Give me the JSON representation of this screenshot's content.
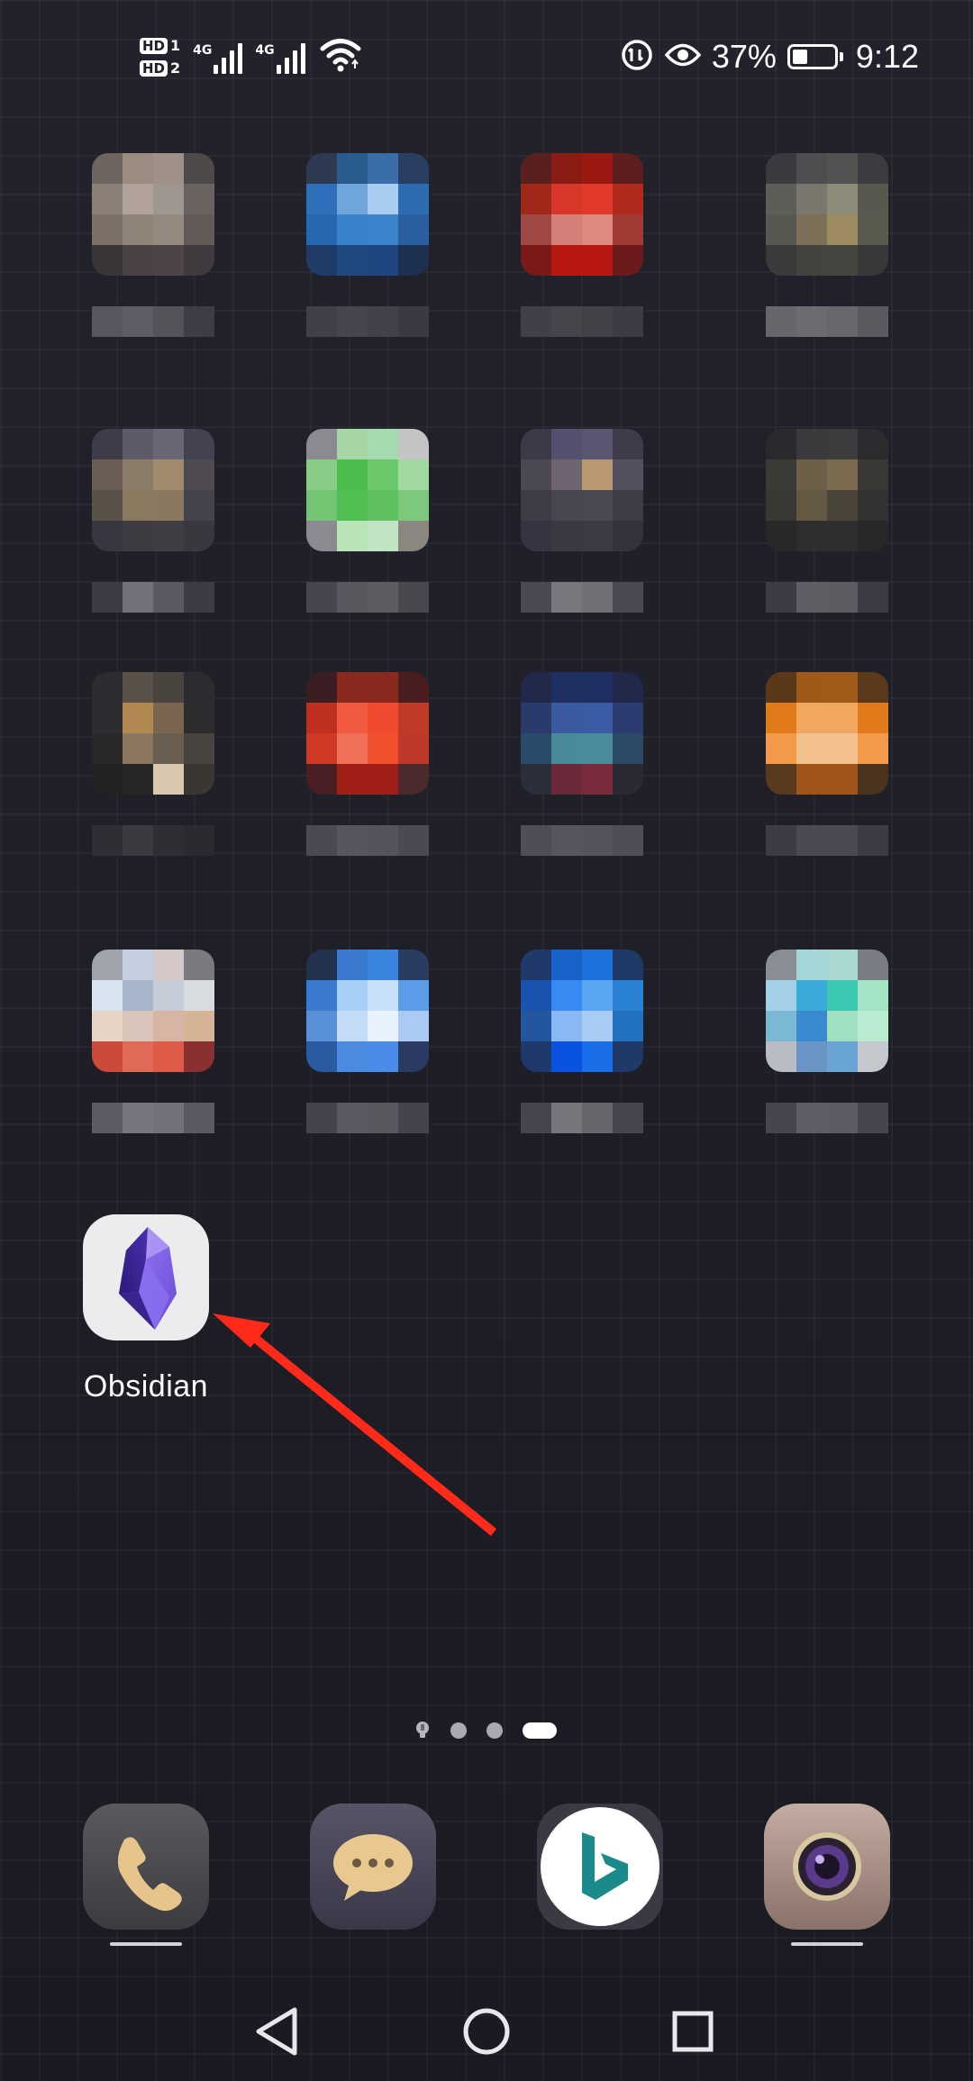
{
  "status_bar": {
    "sim1_badge": "HD",
    "sim1_slot": "1",
    "sim2_badge": "HD",
    "sim2_slot": "2",
    "net1_label": "4G",
    "net2_label": "4G",
    "battery_percent_text": "37%",
    "battery_level": 0.37,
    "time": "9:12",
    "icons": [
      "hd-sim1-icon",
      "hd-sim2-icon",
      "signal-sim1-icon",
      "signal-sim2-icon",
      "wifi-icon",
      "data-saver-icon",
      "eye-comfort-icon",
      "battery-icon"
    ]
  },
  "home_grid": {
    "blurred_apps": [
      {
        "row": 1,
        "col": 1,
        "colors": [
          "#6e6460",
          "#9a8c80",
          "#a0908a",
          "#4e4a4a",
          "#8a8078",
          "#b0a298",
          "#a09690",
          "#6a6260",
          "#7a7068",
          "#908478",
          "#948a80",
          "#625a58",
          "#3a3638",
          "#4a4246",
          "#4c4446",
          "#3e3a3e"
        ],
        "label_colors": [
          "#58565e",
          "#5e5c64",
          "#55535a",
          "#3e3c44"
        ]
      },
      {
        "row": 1,
        "col": 2,
        "colors": [
          "#2e3a52",
          "#2a5c8e",
          "#3a6ea8",
          "#2a3e62",
          "#2f6eb8",
          "#6ea6dc",
          "#a8cdf0",
          "#2e6cb2",
          "#2668b0",
          "#3a82cc",
          "#3c84cc",
          "#2a60a0",
          "#1e3c66",
          "#1e4a80",
          "#1e4680",
          "#1e3050"
        ],
        "label_colors": [
          "#404048",
          "#46464e",
          "#42424a",
          "#3a3a42"
        ]
      },
      {
        "row": 1,
        "col": 3,
        "colors": [
          "#5a2020",
          "#8a1c14",
          "#9a1a12",
          "#5c1e1e",
          "#a02818",
          "#d8382a",
          "#e03a2a",
          "#b02a1e",
          "#a04846",
          "#d4807a",
          "#dc8a80",
          "#a03a32",
          "#7a1a18",
          "#b81812",
          "#b81812",
          "#6a1a1a"
        ],
        "label_colors": [
          "#404048",
          "#45454c",
          "#414148",
          "#3c3c44"
        ]
      },
      {
        "row": 1,
        "col": 4,
        "colors": [
          "#3a3a40",
          "#4e4e50",
          "#525250",
          "#3c3c40",
          "#5e5e58",
          "#7a786c",
          "#8c8a78",
          "#58584e",
          "#585850",
          "#7e7058",
          "#9e8a60",
          "#5a5a4e",
          "#3a3a3a",
          "#44443e",
          "#464640",
          "#383838"
        ],
        "label_colors": [
          "#66666c",
          "#6c6c70",
          "#68686c",
          "#5a5a60"
        ]
      },
      {
        "row": 2,
        "col": 1,
        "colors": [
          "#3e3c48",
          "#5e5a6a",
          "#6a6676",
          "#444250",
          "#6a5e56",
          "#8c7c6a",
          "#a08c6c",
          "#4e4a50",
          "#5a5248",
          "#8c7a60",
          "#8a7860",
          "#44424a",
          "#38363e",
          "#3e3c42",
          "#403e44",
          "#3a383e"
        ],
        "label_colors": [
          "#3c3c44",
          "#72727a",
          "#5a5a62",
          "#3c3c44"
        ]
      },
      {
        "row": 2,
        "col": 2,
        "colors": [
          "#8a8a90",
          "#a6d6a6",
          "#a4dcb0",
          "#c4c4c4",
          "#88cc88",
          "#4cbc4c",
          "#6ac86a",
          "#a0d8a0",
          "#74c474",
          "#50be50",
          "#5ec05e",
          "#7ec87e",
          "#8a8a90",
          "#b8e4b8",
          "#c0e4c4",
          "#8a8680"
        ],
        "label_colors": [
          "#46464e",
          "#58585e",
          "#5c5c62",
          "#48484e"
        ]
      },
      {
        "row": 2,
        "col": 3,
        "colors": [
          "#3c3a48",
          "#545070",
          "#5a5672",
          "#3e3c4a",
          "#4c4854",
          "#6e6470",
          "#b89870",
          "#545060",
          "#3e3c44",
          "#4a4650",
          "#4c4852",
          "#3e3c44",
          "#363440",
          "#3a3842",
          "#3c3a44",
          "#34323c"
        ],
        "label_colors": [
          "#4a4a52",
          "#78787e",
          "#707076",
          "#4a4a52"
        ]
      },
      {
        "row": 2,
        "col": 4,
        "colors": [
          "#2a2a2e",
          "#3a3a3c",
          "#3c3c3e",
          "#2c2c30",
          "#3c3a36",
          "#6c6048",
          "#7a6a4e",
          "#3a3834",
          "#3a3834",
          "#645a44",
          "#4a4438",
          "#343230",
          "#282828",
          "#2e2e2e",
          "#2e2e2e",
          "#282828"
        ],
        "label_colors": [
          "#3c3c44",
          "#5e5e64",
          "#5c5c62",
          "#3c3c44"
        ]
      },
      {
        "row": 3,
        "col": 1,
        "colors": [
          "#2e2c30",
          "#5a5248",
          "#4a443e",
          "#2e2c30",
          "#2e2c30",
          "#b08850",
          "#7a6650",
          "#2e2c2e",
          "#2a2828",
          "#8c7860",
          "#6a5e50",
          "#4a4440",
          "#222222",
          "#262626",
          "#d8c8b0",
          "#3a3632"
        ],
        "label_colors": [
          "#2e2e34",
          "#3a3a40",
          "#2e2e34",
          "#2a2a30"
        ]
      },
      {
        "row": 3,
        "col": 2,
        "colors": [
          "#3c1e22",
          "#8a2a1e",
          "#8a2a1e",
          "#4a1e20",
          "#c03020",
          "#f05a40",
          "#f04a30",
          "#c03a28",
          "#d03a24",
          "#f07058",
          "#f0502e",
          "#c0382a",
          "#4a1e22",
          "#a02018",
          "#a01e18",
          "#4a2a2c"
        ],
        "label_colors": [
          "#4a4a52",
          "#56565e",
          "#54545c",
          "#4a4a52"
        ]
      },
      {
        "row": 3,
        "col": 3,
        "colors": [
          "#22284a",
          "#1e3060",
          "#1e3062",
          "#22284a",
          "#2a3a6a",
          "#3a5aa0",
          "#3a5ca4",
          "#2a3c70",
          "#2a4a6a",
          "#4a8a9a",
          "#4a8c9c",
          "#2a4a66",
          "#2a2e3a",
          "#6a2a3a",
          "#7a2a3a",
          "#2a2a34"
        ],
        "label_colors": [
          "#4e4e56",
          "#56565e",
          "#54545c",
          "#4e4e56"
        ]
      },
      {
        "row": 3,
        "col": 4,
        "colors": [
          "#5a3818",
          "#a05a18",
          "#a05a1a",
          "#5a3a1a",
          "#e07a1a",
          "#f0a860",
          "#f0a860",
          "#e07a1a",
          "#f09a4a",
          "#f4c08c",
          "#f4c08c",
          "#f09a4a",
          "#5a3a1e",
          "#a0561a",
          "#a0561a",
          "#4a341e"
        ],
        "label_colors": [
          "#3c3c44",
          "#4a4a52",
          "#4a4a52",
          "#3c3c44"
        ]
      },
      {
        "row": 4,
        "col": 1,
        "colors": [
          "#a0a4ac",
          "#c4d0e0",
          "#d4c8c8",
          "#7a7a80",
          "#d8e4f0",
          "#a8b4c8",
          "#c4ccd8",
          "#d8dce0",
          "#e8d4c4",
          "#d8c4b8",
          "#d8b4a4",
          "#d4b494",
          "#cc4a3a",
          "#e06a58",
          "#e05a48",
          "#8a3030"
        ],
        "label_colors": [
          "#5c5c64",
          "#76767e",
          "#72727a",
          "#5a5a62"
        ]
      },
      {
        "row": 4,
        "col": 2,
        "colors": [
          "#22324e",
          "#3a7ad0",
          "#3a84de",
          "#2a3c62",
          "#3a7ad0",
          "#a8d0f4",
          "#c8e0f8",
          "#5a9ce8",
          "#5a90d8",
          "#c4dcf6",
          "#e8f2fc",
          "#aacaf4",
          "#2a5aa0",
          "#4a8ae0",
          "#4a8ae8",
          "#2a3a62"
        ],
        "label_colors": [
          "#44444c",
          "#5a5a62",
          "#58585e",
          "#44444c"
        ]
      },
      {
        "row": 4,
        "col": 3,
        "colors": [
          "#1e3a6a",
          "#1a62c8",
          "#1a72da",
          "#1e3a66",
          "#1a52b0",
          "#3a8af4",
          "#5aa4f4",
          "#2a82d4",
          "#2456a0",
          "#8ab8f4",
          "#a8ccf4",
          "#2270c0",
          "#1e3a6a",
          "#0a52e0",
          "#1a6ee8",
          "#1e3a66"
        ],
        "label_colors": [
          "#46464e",
          "#76767c",
          "#66666c",
          "#46464e"
        ]
      },
      {
        "row": 4,
        "col": 4,
        "colors": [
          "#8a8e94",
          "#a4d8d8",
          "#a8d8d0",
          "#7a7e84",
          "#a4d0e8",
          "#3aaad8",
          "#3ac8b0",
          "#a4e4c4",
          "#7ab8d4",
          "#3a8ad0",
          "#a0e0c0",
          "#b8ecd0",
          "#b8bcc4",
          "#6a94c4",
          "#6aa4d4",
          "#c4c8cc"
        ],
        "label_colors": [
          "#46464e",
          "#5e5e66",
          "#5c5c64",
          "#46464e"
        ]
      }
    ]
  },
  "obsidian": {
    "label": "Obsidian",
    "icon": "obsidian-crystal-icon"
  },
  "annotation": {
    "arrow_color": "#ff2a1a",
    "icon": "red-arrow-annotation"
  },
  "page_indicator": {
    "pages": 4,
    "active_page": 4,
    "first_is_search": true,
    "icon": "lightbulb-search-icon"
  },
  "dock": {
    "apps": [
      {
        "name": "phone",
        "icon": "phone-icon",
        "running_indicator": true
      },
      {
        "name": "messages",
        "icon": "message-bubble-icon",
        "running_indicator": false
      },
      {
        "name": "bing",
        "icon": "bing-icon",
        "running_indicator": false
      },
      {
        "name": "camera",
        "icon": "camera-lens-icon",
        "running_indicator": true
      }
    ]
  },
  "navigation": {
    "icons": [
      "back-triangle-icon",
      "home-circle-icon",
      "recents-square-icon"
    ]
  }
}
